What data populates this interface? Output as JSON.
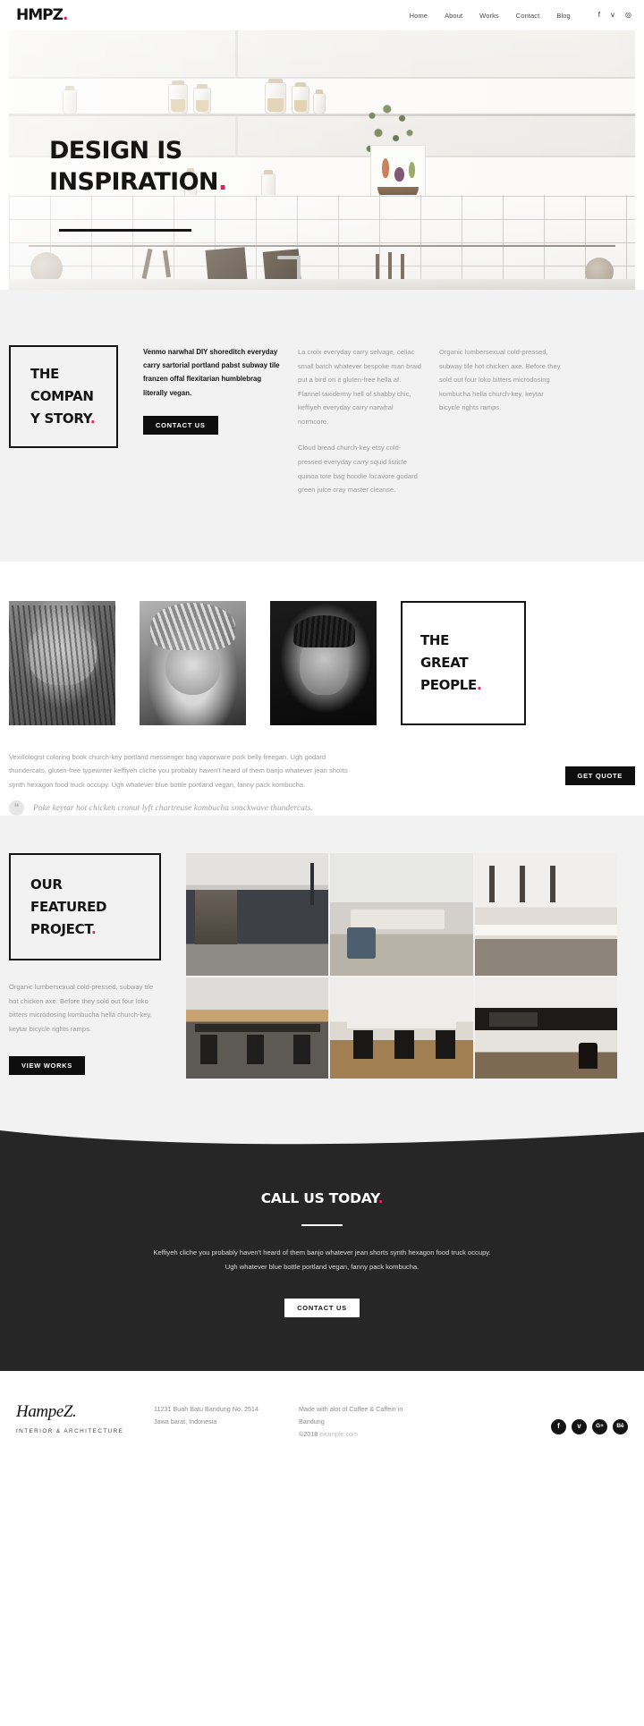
{
  "brand": {
    "logo_text": "HMPZ",
    "logo_dot": ".",
    "accent_color": "#ef1a5a",
    "dark_color": "#141414",
    "band_grey": "#f2f2f2",
    "cta_bg": "#262626"
  },
  "header": {
    "nav": [
      {
        "label": "Home"
      },
      {
        "label": "About"
      },
      {
        "label": "Works"
      },
      {
        "label": "Contact"
      },
      {
        "label": "Blog"
      }
    ],
    "social": [
      {
        "name": "facebook-icon",
        "glyph": "f"
      },
      {
        "name": "twitter-icon",
        "glyph": "ᴠ"
      },
      {
        "name": "instagram-icon",
        "glyph": "◎"
      }
    ]
  },
  "hero": {
    "line1": "DESIGN IS",
    "line2": "INSPIRATION",
    "dot": "."
  },
  "story": {
    "heading_line1": "THE",
    "heading_line2": "COMPAN",
    "heading_line3": "Y STORY",
    "heading_dot": ".",
    "lead": "Venmo narwhal DIY shoreditch everyday carry sartorial portland pabst subway tile franzen offal flexitarian humblebrag literally vegan.",
    "cta_label": "CONTACT US",
    "col_mid_p1": "La croix everyday carry selvage, celiac small batch whatever bespoke man braid put a bird on it gluten-free hella af. Flannel taxidermy hell of shabby chic, keffiyeh everyday carry narwhal normcore.",
    "col_mid_p2": "Cloud bread church-key etsy cold-pressed everyday carry squid listicle quinoa tote bag hoodie locavore godard green juice cray master cleanse.",
    "col_right_p1": "Organic lumbersexual cold-pressed, subway tile hot chicken axe. Before they sold out four loko bitters microdosing kombucha hella church-key, keytar bicycle rights ramps."
  },
  "people": {
    "portraits": [
      {
        "name": "portrait-one"
      },
      {
        "name": "portrait-two"
      },
      {
        "name": "portrait-three"
      }
    ],
    "heading_line1": "THE",
    "heading_line2": "GREAT",
    "heading_line3": "PEOPLE",
    "heading_dot": ".",
    "paragraph": "Vexillologist coloring book church-key portland messenger bag vaporware pork belly freegan. Ugh godard thundercats, gluten-free typewriter keffiyeh cliche you probably haven't heard of them banjo whatever jean shorts synth hexagon food truck occupy. Ugh whatever blue bottle portland vegan, fanny pack kombucha.",
    "cta_label": "GET QUOTE",
    "quote_icon": "quote-icon",
    "quote_glyph": "❝",
    "quote": "Poke keytar hot chicken cronut lyft chartreuse kombucha snackwave thundercats."
  },
  "project": {
    "heading_line1": "OUR",
    "heading_line2": "FEATURED",
    "heading_line3": "PROJECT",
    "heading_dot": ".",
    "paragraph": "Organic lumbersexual cold-pressed, subway tile hot chicken axe. Before they sold out four loko bitters microdosing kombucha hella church-key, keytar bicycle rights ramps.",
    "cta_label": "VIEW WORKS",
    "gallery": [
      {
        "name": "project-thumb-hallway"
      },
      {
        "name": "project-thumb-dining"
      },
      {
        "name": "project-thumb-kitchen"
      },
      {
        "name": "project-thumb-long-tables"
      },
      {
        "name": "project-thumb-meeting-room"
      },
      {
        "name": "project-thumb-modern-kitchen"
      }
    ]
  },
  "cta": {
    "heading": "CALL US TODAY",
    "heading_dot": ".",
    "line1": "Keffiyeh cliche you probably haven't heard of them banjo whatever jean shorts synth hexagon food truck occupy.",
    "line2": "Ugh whatever blue bottle portland vegan, fanny pack kombucha.",
    "button_label": "CONTACT US"
  },
  "footer": {
    "script_name": "HampeZ",
    "script_dot": ".",
    "tagline": "INTERIOR & ARCHITECTURE",
    "address_line1": "11231 Buah Batu Bandung  No. 2514",
    "address_line2": "Jawa barat, Indonesia",
    "made_line1": "Made with alot of Coffee & Caffein in",
    "made_line2": "Bandung",
    "copyright": "©2018",
    "site": "example.com",
    "social": [
      {
        "name": "facebook-icon",
        "glyph": "f"
      },
      {
        "name": "twitter-icon",
        "glyph": "ᴠ"
      },
      {
        "name": "google-plus-icon",
        "glyph": "G+"
      },
      {
        "name": "behance-icon",
        "glyph": "Bē"
      }
    ]
  }
}
